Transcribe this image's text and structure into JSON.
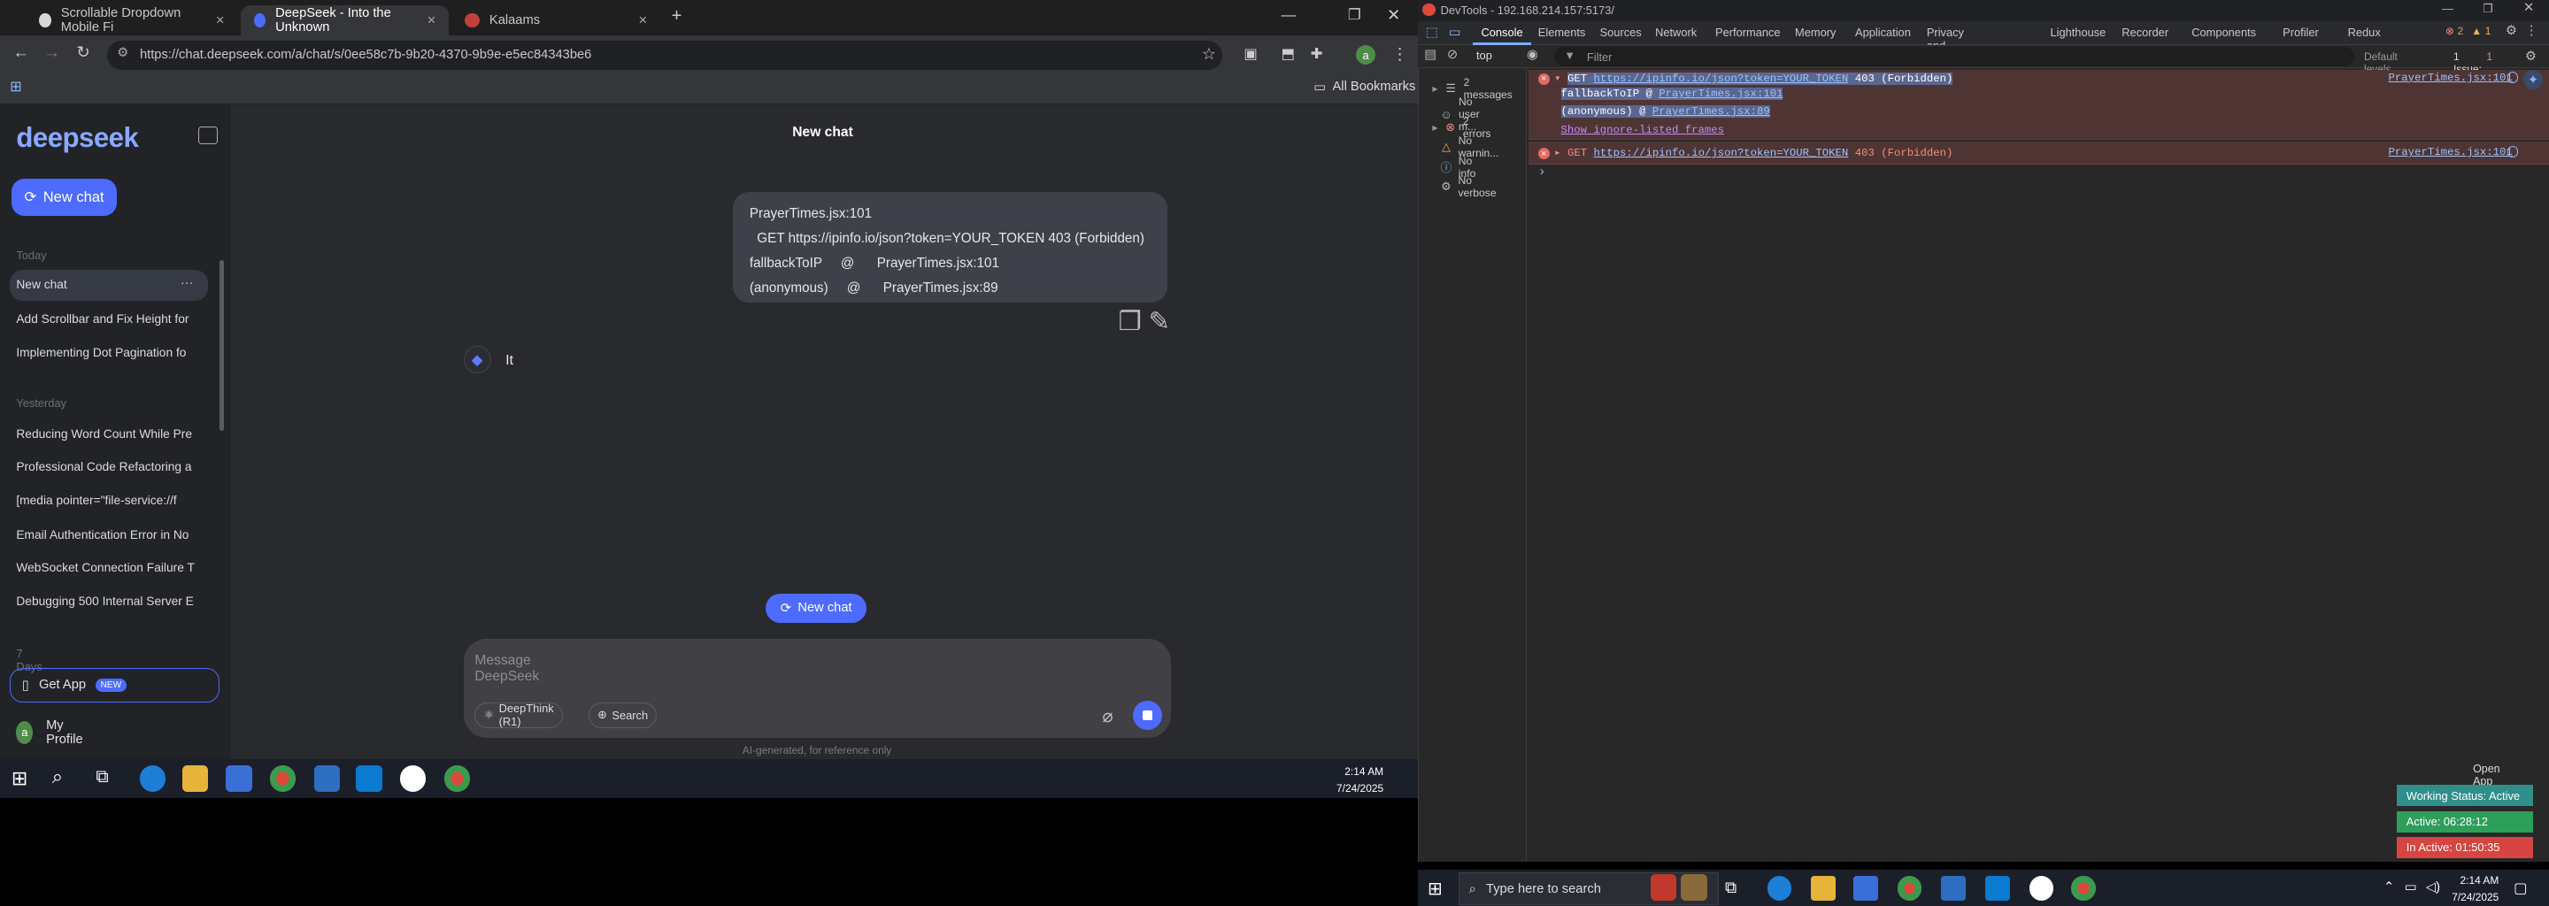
{
  "browser": {
    "tabs": [
      {
        "title": "Scrollable Dropdown Mobile Fi",
        "close": "×"
      },
      {
        "title": "DeepSeek - Into the Unknown",
        "close": "×"
      },
      {
        "title": "Kalaams",
        "close": "×"
      }
    ],
    "new_tab": "+",
    "url": "https://chat.deepseek.com/a/chat/s/0ee58c7b-9b20-4370-9b9e-e5ec84343be6",
    "all_bookmarks": "All Bookmarks",
    "profile_initial": "a"
  },
  "sidebar": {
    "logo": "deepseek",
    "new_chat": "New chat",
    "sections": [
      {
        "label": "Today",
        "items": [
          "New chat",
          "Add Scrollbar and Fix Height for",
          "Implementing Dot Pagination fo"
        ]
      },
      {
        "label": "Yesterday",
        "items": [
          "Reducing Word Count While Pre",
          "Professional Code Refactoring a",
          "[media pointer=\"file-service://f",
          "Email Authentication Error in No",
          "WebSocket Connection Failure T",
          "Debugging 500 Internal Server E"
        ]
      },
      {
        "label": "7 Days",
        "items": []
      }
    ],
    "more_dots": "···",
    "get_app": "Get App",
    "new_badge": "NEW",
    "profile": "My Profile",
    "profile_initial": "a"
  },
  "chat": {
    "title": "New chat",
    "user_message": [
      "PrayerTimes.jsx:101",
      "  GET https://ipinfo.io/json?token=YOUR_TOKEN 403 (Forbidden)",
      "fallbackToIP     @      PrayerTimes.jsx:101",
      "(anonymous)     @      PrayerTimes.jsx:89"
    ],
    "assistant_reply": "It",
    "floating_new_chat": "New chat",
    "input_placeholder": "Message DeepSeek",
    "deepthink": "DeepThink (R1)",
    "search": "Search",
    "disclaimer": "AI-generated, for reference only"
  },
  "taskbar_left": {
    "time": "2:14 AM",
    "date": "7/24/2025"
  },
  "devtools": {
    "title": "DevTools - 192.168.214.157:5173/",
    "tabs": [
      "Console",
      "Elements",
      "Sources",
      "Network",
      "Performance",
      "Memory",
      "Application",
      "Privacy and security",
      "Lighthouse",
      "Recorder",
      "Components",
      "Profiler",
      "Redux"
    ],
    "error_count": "2",
    "warn_count": "1",
    "context": "top",
    "filter_placeholder": "Filter",
    "levels": "Default levels",
    "issues": "1 Issue:",
    "issues_count": "1",
    "sidebar": [
      {
        "label": "2 messages",
        "icon": "list"
      },
      {
        "label": "No user m...",
        "icon": "user"
      },
      {
        "label": "2 errors",
        "icon": "error"
      },
      {
        "label": "No warnin...",
        "icon": "warning"
      },
      {
        "label": "No info",
        "icon": "info"
      },
      {
        "label": "No verbose",
        "icon": "verbose"
      }
    ],
    "error1": {
      "method": "GET",
      "url": "https://ipinfo.io/json?token=YOUR_TOKEN",
      "status": "403 (Forbidden)",
      "frames": [
        {
          "fn": "fallbackToIP",
          "at": "@",
          "src": "PrayerTimes.jsx:101"
        },
        {
          "fn": "(anonymous)",
          "at": "@",
          "src": "PrayerTimes.jsx:89"
        }
      ],
      "ignore_link": "Show ignore-listed frames",
      "source": "PrayerTimes.jsx:101"
    },
    "error2": {
      "method": "GET",
      "url": "https://ipinfo.io/json?token=YOUR_TOKEN",
      "status": "403 (Forbidden)",
      "source": "PrayerTimes.jsx:101"
    },
    "prompt": "›"
  },
  "widget": {
    "open_app": "Open App",
    "status": "Working Status: Active",
    "active": "Active: 06:28:12",
    "inactive": "In Active: 01:50:35",
    "colors": {
      "status": "#2f8f8a",
      "active": "#2e9e5b",
      "inactive": "#d64541"
    }
  },
  "taskbar_right": {
    "search": "Type here to search",
    "time": "2:14 AM",
    "date": "7/24/2025"
  }
}
